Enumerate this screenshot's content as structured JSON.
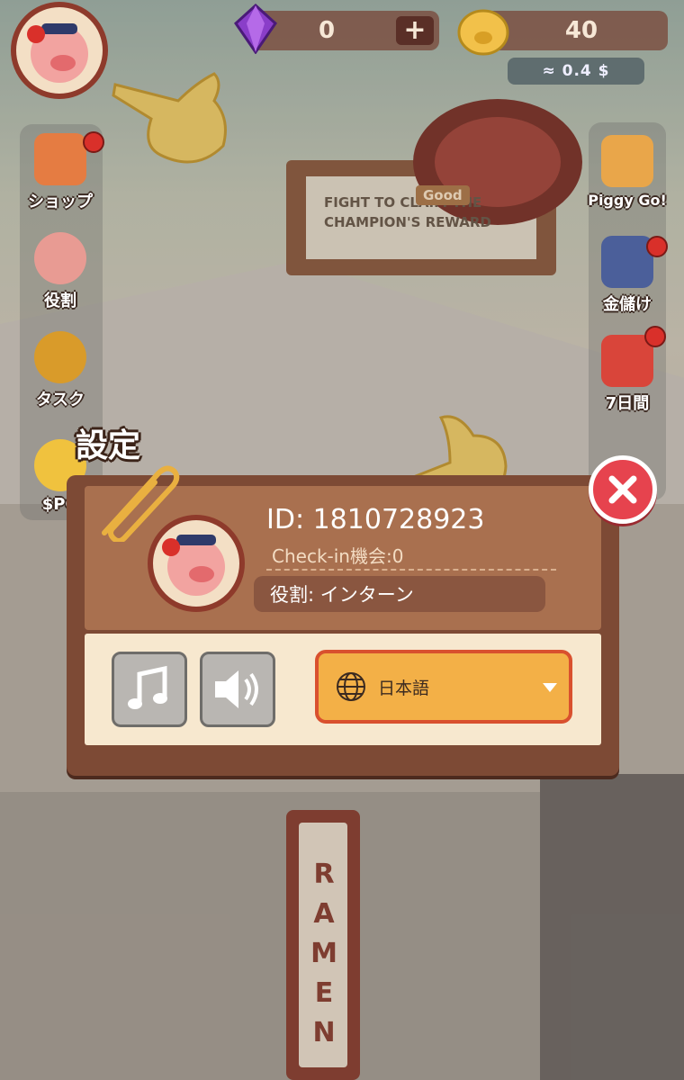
{
  "hud": {
    "gems": "0",
    "coins": "40",
    "usd_estimate": "≈ 0.4 $",
    "plus_icon": "plus-icon",
    "gem_icon": "purple-gem-icon",
    "coin_icon": "pig-coin-icon"
  },
  "left_menu": [
    {
      "label": "ショップ",
      "icon": "shop-icon",
      "badge": true
    },
    {
      "label": "役割",
      "icon": "role-icon",
      "badge": false
    },
    {
      "label": "タスク",
      "icon": "task-medal-icon",
      "badge": false
    },
    {
      "label": "$PG",
      "icon": "pg-coin-icon",
      "badge": false
    }
  ],
  "right_menu": [
    {
      "label": "Piggy Go!",
      "icon": "piggy-go-icon",
      "badge": false
    },
    {
      "label": "金儲け",
      "icon": "money-pig-icon",
      "badge": true
    },
    {
      "label": "7日間",
      "icon": "gift-cart-icon",
      "badge": true
    }
  ],
  "scene": {
    "sign_text": "FIGHT TO CLAIM THE CHAMPION'S REWARD",
    "sign_badge": "Good",
    "ramen_sign": "RAMEN"
  },
  "settings": {
    "title": "設定",
    "user_id": "ID: 1810728923",
    "checkin": "Check-in機会:0",
    "role": "役割: インターン",
    "language": "日本語",
    "music_icon": "music-note-icon",
    "sound_icon": "speaker-icon",
    "globe_icon": "globe-icon",
    "dropdown_icon": "triangle-down-icon",
    "close_icon": "close-x-icon"
  },
  "colors": {
    "modal_frame": "#7d4a35",
    "modal_header": "#a9704f",
    "modal_body": "#f7e8cf",
    "language_button": "#f3b047",
    "close_button": "#e6434e"
  }
}
